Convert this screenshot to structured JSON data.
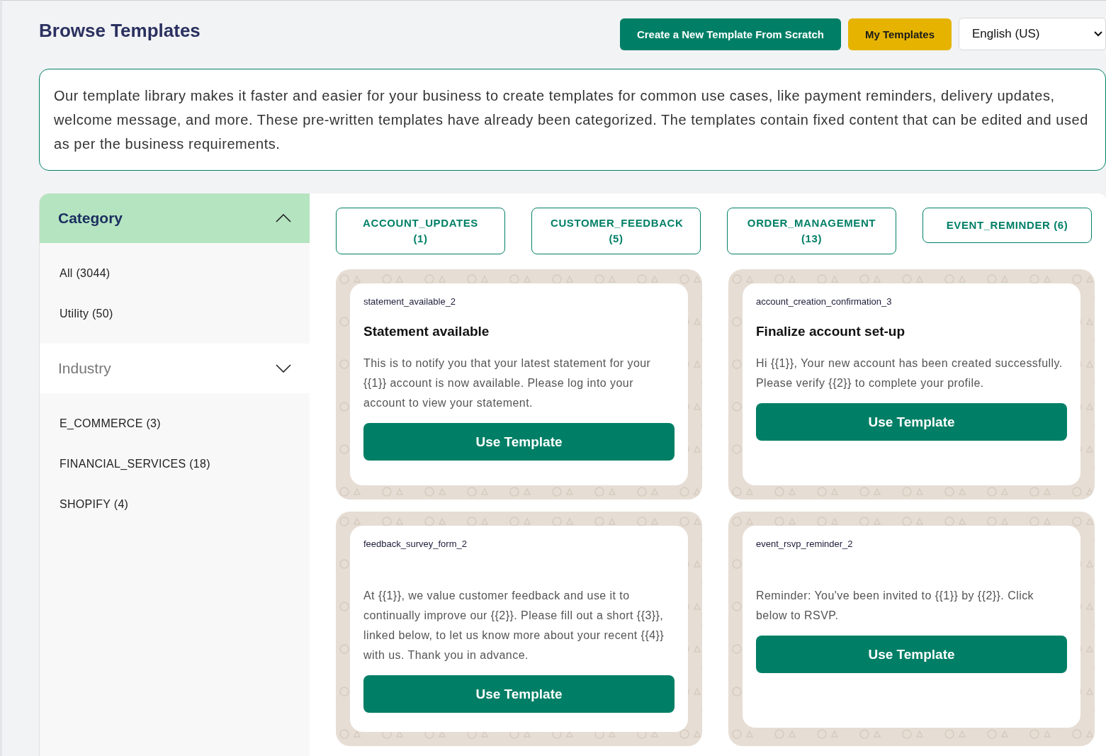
{
  "header": {
    "title": "Browse Templates",
    "buttons": [
      {
        "label": "Create a New Template From Scratch",
        "kind": "primary"
      },
      {
        "label": "My Templates",
        "kind": "secondary"
      }
    ],
    "language": "English (US)"
  },
  "intro": "Our template library makes it faster and easier for your business to create templates for common use cases, like payment reminders, delivery updates, welcome message, and more. These pre-written templates have already been categorized. The templates contain fixed content that can be edited and used as per the business requirements.",
  "sidebar": [
    {
      "title": "Category",
      "selected": true,
      "items": [
        "All (3044)",
        "Utility (50)"
      ]
    },
    {
      "title": "Industry",
      "selected": false,
      "items": [
        "E_COMMERCE (3)",
        "FINANCIAL_SERVICES (18)",
        "SHOPIFY (4)"
      ]
    }
  ],
  "filters": [
    "ACCOUNT_UPDATES (1)",
    "CUSTOMER_FEEDBACK (5)",
    "ORDER_MANAGEMENT (13)",
    "EVENT_REMINDER (6)"
  ],
  "templates": [
    {
      "name": "statement_available_2",
      "title": "Statement available",
      "body": "This is to notify you that your latest statement for your {{1}} account is now available. Please log into your account to view your statement.",
      "button": "Use Template"
    },
    {
      "name": "account_creation_confirmation_3",
      "title": "Finalize account set-up",
      "body": "Hi {{1}}, Your new account has been created successfully. Please verify {{2}} to complete your profile.",
      "button": "Use Template"
    },
    {
      "name": "feedback_survey_form_2",
      "body": "At {{1}}, we value customer feedback and use it to continually improve our {{2}}. Please fill out a short {{3}}, linked below, to let us know more about your recent {{4}} with us. Thank you in advance.",
      "button": "Use Template"
    },
    {
      "name": "event_rsvp_reminder_2",
      "body": "Reminder: You've been invited to {{1}} by {{2}}. Click below to RSVP.",
      "button": "Use Template"
    }
  ]
}
